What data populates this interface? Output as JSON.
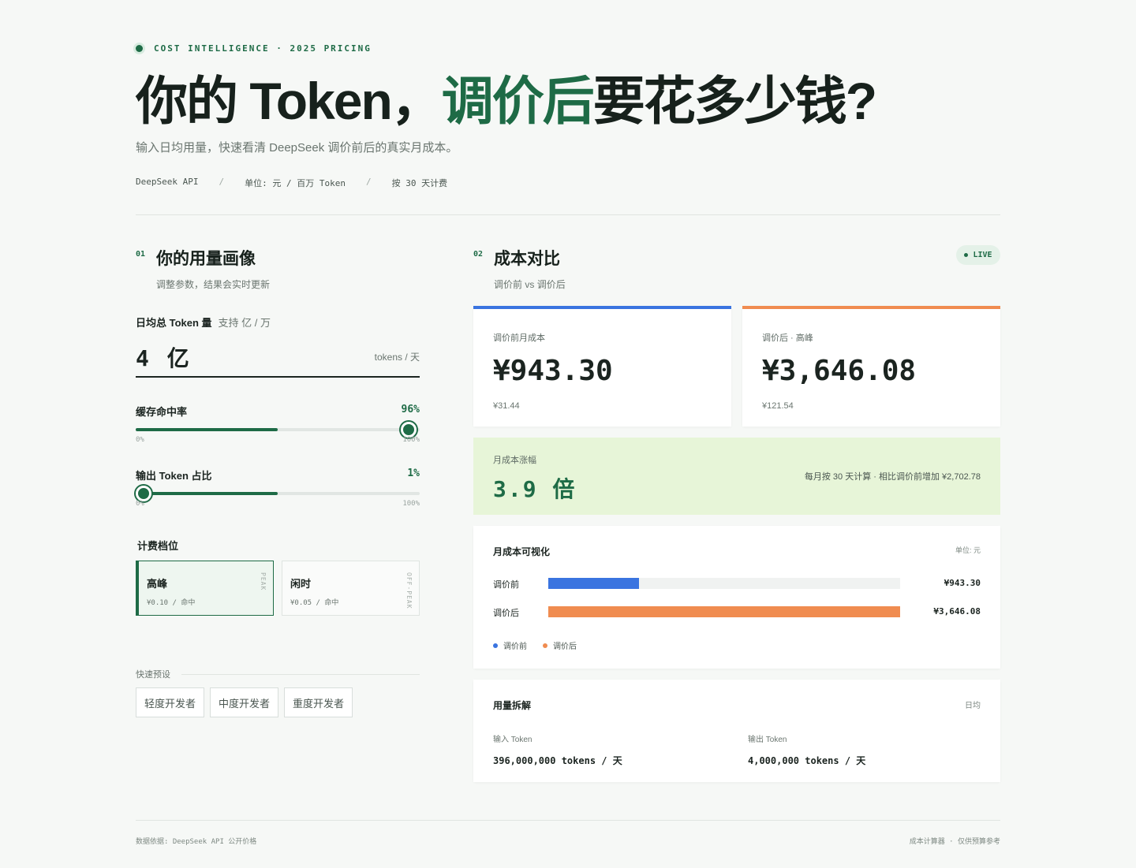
{
  "header": {
    "eyebrow": "COST INTELLIGENCE · 2025 PRICING",
    "title_before": "你的 Token，",
    "title_highlight": "调价后",
    "title_after": "要花多少钱?",
    "subtitle": "输入日均用量，快速看清 DeepSeek 调价前后的真实月成本。",
    "meta": [
      "DeepSeek API",
      "单位: 元 / 百万 Token",
      "按 30 天计费"
    ],
    "meta_sep": "/"
  },
  "usage_panel": {
    "num": "01",
    "title": "你的用量画像",
    "subtitle": "调整参数，结果会实时更新",
    "daily_label": "日均总 Token 量",
    "daily_hint": "支持 亿 / 万",
    "daily_value": "4 亿",
    "daily_unit": "tokens / 天",
    "cache": {
      "label": "缓存命中率",
      "value_text": "96%",
      "value": 96,
      "fill": 50,
      "min": "0%",
      "max": "100%"
    },
    "output": {
      "label": "输出 Token 占比",
      "value_text": "1%",
      "value": 1,
      "fill": 50,
      "min": "0%",
      "max": "100%"
    },
    "tier_label": "计费档位",
    "tiers": [
      {
        "name": "高峰",
        "price": "¥0.10 / 命中",
        "tag": "PEAK"
      },
      {
        "name": "闲时",
        "price": "¥0.05 / 命中",
        "tag": "OFF-PEAK"
      }
    ],
    "preset_label": "快速预设",
    "presets": [
      "轻度开发者",
      "中度开发者",
      "重度开发者"
    ]
  },
  "cost_panel": {
    "num": "02",
    "title": "成本对比",
    "subtitle": "调价前 vs 调价后",
    "live": "LIVE",
    "before": {
      "label": "调价前月成本",
      "value": "¥943.30",
      "sub": "¥31.44"
    },
    "after": {
      "label": "调价后 · 高峰",
      "value": "¥3,646.08",
      "sub": "¥121.54"
    },
    "multiplier": {
      "label": "月成本涨幅",
      "value": "3.9 倍",
      "note": "每月按 30 天计算 · 相比调价前增加 ¥2,702.78"
    },
    "viz": {
      "title": "月成本可视化",
      "unit": "单位: 元"
    },
    "usage": {
      "title": "用量拆解",
      "unit": "日均",
      "input_label": "输入 Token",
      "input_value": "396,000,000 tokens / 天",
      "output_label": "输出 Token",
      "output_value": "4,000,000 tokens / 天"
    }
  },
  "chart_data": {
    "type": "bar",
    "categories": [
      "调价前",
      "调价后"
    ],
    "values": [
      943.3,
      3646.08
    ],
    "value_labels": [
      "¥943.30",
      "¥3,646.08"
    ],
    "colors": [
      "#3a74e0",
      "#f08c50"
    ],
    "legend": [
      "调价前",
      "调价后"
    ],
    "xlim": [
      0,
      3646.08
    ]
  },
  "footer": {
    "left": "数据依据: DeepSeek API 公开价格",
    "right": "成本计算器 · 仅供预算参考"
  },
  "colors": {
    "accent": "#1e6b46",
    "highlight": "#c9ef62",
    "before": "#3a74e0",
    "after": "#f08c50"
  }
}
